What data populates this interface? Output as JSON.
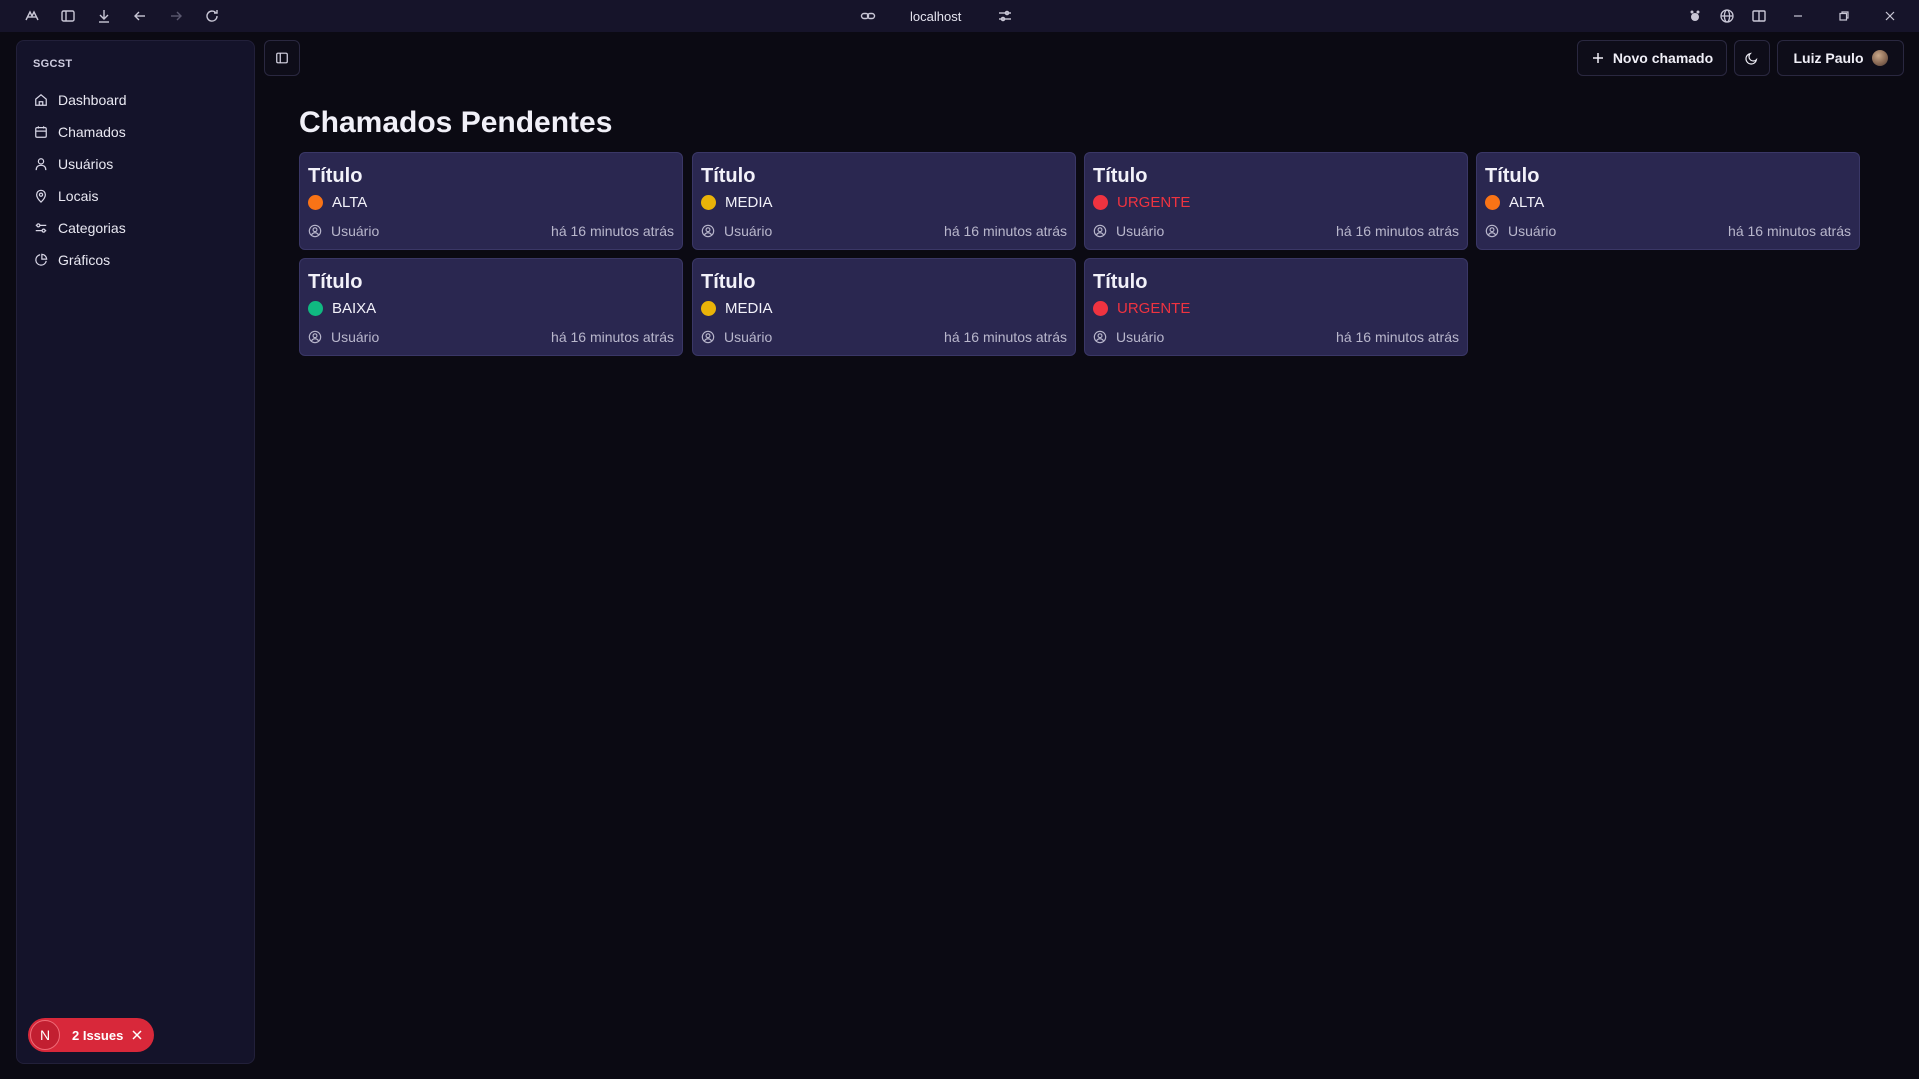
{
  "browser": {
    "url": "localhost"
  },
  "sidebar": {
    "brand": "SGCST",
    "items": [
      {
        "label": "Dashboard",
        "icon": "home-icon"
      },
      {
        "label": "Chamados",
        "icon": "calendar-icon"
      },
      {
        "label": "Usuários",
        "icon": "user-icon"
      },
      {
        "label": "Locais",
        "icon": "map-pin-icon"
      },
      {
        "label": "Categorias",
        "icon": "sliders-icon"
      },
      {
        "label": "Gráficos",
        "icon": "pie-chart-icon"
      }
    ],
    "issues": {
      "initial": "N",
      "label": "2 Issues"
    }
  },
  "header": {
    "new_button": "Novo chamado",
    "user_name": "Luiz Paulo"
  },
  "main": {
    "title": "Chamados Pendentes",
    "cards": [
      {
        "title": "Título",
        "priority": "ALTA",
        "priority_color": "#f97316",
        "label_color": "#f2f1f9",
        "user": "Usuário",
        "time": "há 16 minutos atrás"
      },
      {
        "title": "Título",
        "priority": "MEDIA",
        "priority_color": "#eab308",
        "label_color": "#f2f1f9",
        "user": "Usuário",
        "time": "há 16 minutos atrás"
      },
      {
        "title": "Título",
        "priority": "URGENTE",
        "priority_color": "#ef3340",
        "label_color": "#ef3340",
        "user": "Usuário",
        "time": "há 16 minutos atrás"
      },
      {
        "title": "Título",
        "priority": "ALTA",
        "priority_color": "#f97316",
        "label_color": "#f2f1f9",
        "user": "Usuário",
        "time": "há 16 minutos atrás"
      },
      {
        "title": "Título",
        "priority": "BAIXA",
        "priority_color": "#10b981",
        "label_color": "#f2f1f9",
        "user": "Usuário",
        "time": "há 16 minutos atrás"
      },
      {
        "title": "Título",
        "priority": "MEDIA",
        "priority_color": "#eab308",
        "label_color": "#f2f1f9",
        "user": "Usuário",
        "time": "há 16 minutos atrás"
      },
      {
        "title": "Título",
        "priority": "URGENTE",
        "priority_color": "#ef3340",
        "label_color": "#ef3340",
        "user": "Usuário",
        "time": "há 16 minutos atrás"
      }
    ]
  }
}
